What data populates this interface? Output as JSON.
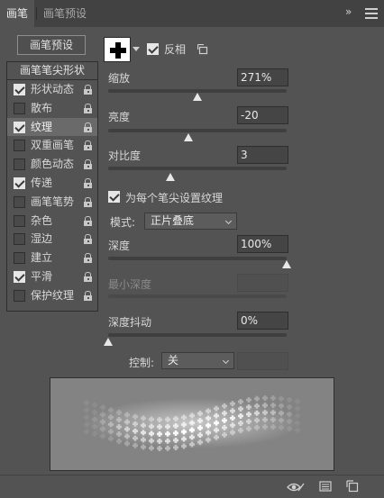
{
  "tabs": [
    {
      "label": "画笔",
      "active": true
    },
    {
      "label": "画笔预设",
      "active": false
    }
  ],
  "tab_more": "»",
  "preset_button": "画笔预设",
  "left_panel": {
    "header": "画笔笔尖形状",
    "items": [
      {
        "label": "形状动态",
        "checked": true
      },
      {
        "label": "散布",
        "checked": false
      },
      {
        "label": "纹理",
        "checked": true,
        "selected": true
      },
      {
        "label": "双重画笔",
        "checked": false
      },
      {
        "label": "颜色动态",
        "checked": false
      },
      {
        "label": "传递",
        "checked": true
      },
      {
        "label": "画笔笔势",
        "checked": false
      },
      {
        "label": "杂色",
        "checked": false
      },
      {
        "label": "湿边",
        "checked": false
      },
      {
        "label": "建立",
        "checked": false
      },
      {
        "label": "平滑",
        "checked": true
      },
      {
        "label": "保护纹理",
        "checked": false
      }
    ]
  },
  "texture": {
    "invert_label": "反相",
    "invert_checked": true,
    "scale": {
      "label": "缩放",
      "value": "271%",
      "fraction": 0.5
    },
    "brightness": {
      "label": "亮度",
      "value": "-20",
      "fraction": 0.45
    },
    "contrast": {
      "label": "对比度",
      "value": "3",
      "fraction": 0.35
    },
    "per_tip_label": "为每个笔尖设置纹理",
    "per_tip_checked": true,
    "mode_label": "模式:",
    "mode_value": "正片叠底",
    "depth": {
      "label": "深度",
      "value": "100%",
      "fraction": 1.0
    },
    "min_depth": {
      "label": "最小深度",
      "value": ""
    },
    "depth_jitter": {
      "label": "深度抖动",
      "value": "0%",
      "fraction": 0.0
    },
    "control_label": "控制:",
    "control_value": "关"
  },
  "colors": {
    "panel_bg": "#535353",
    "tab_bar_bg": "#424242",
    "field_bg": "#454545",
    "slider_thumb": "#e8e8e8"
  },
  "icons": [
    "brush-tip-swatch-icon",
    "new-pattern-icon",
    "lock-icon",
    "eye-toggle-icon",
    "grid-icon",
    "new-preset-icon"
  ]
}
